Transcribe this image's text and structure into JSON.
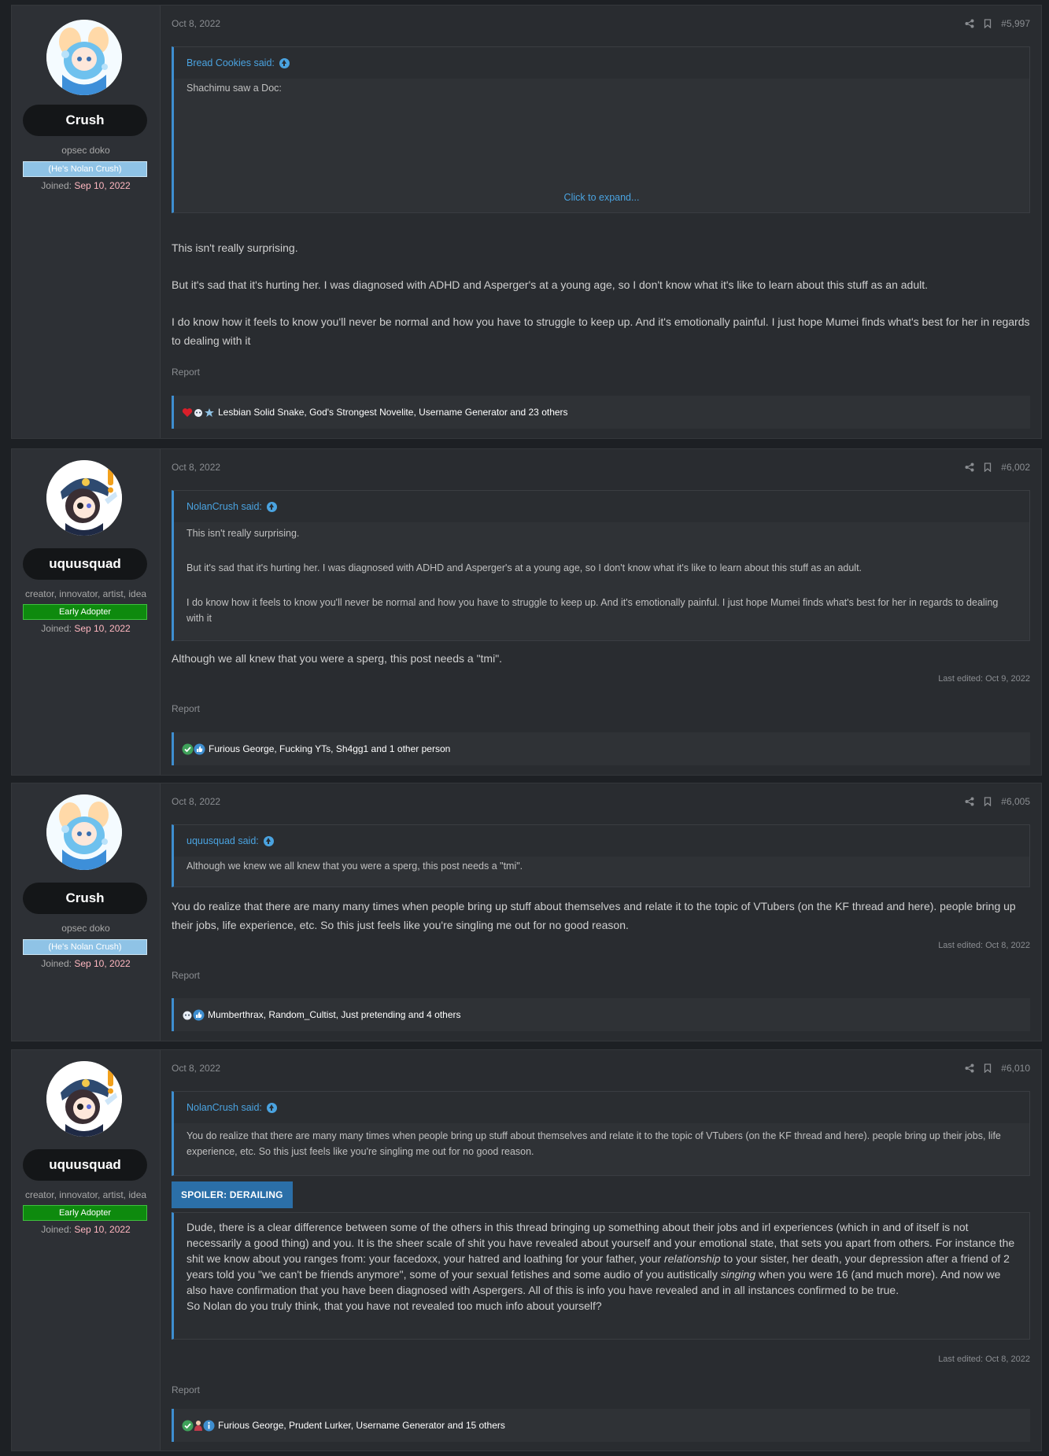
{
  "posts": [
    {
      "user": {
        "name": "Crush",
        "title": "opsec doko",
        "banner": "(He's Nolan Crush)",
        "joined_label": "Joined:",
        "joined": "Sep 10, 2022"
      },
      "date": "Oct 8, 2022",
      "number": "#5,997",
      "quote": {
        "author": "Bread Cookies said:",
        "lines": [
          "Shachimu saw a Doc:"
        ],
        "expand": "Click to expand..."
      },
      "body": [
        "This isn't really surprising.",
        "But it's sad that it's hurting her. I was diagnosed with ADHD and Asperger's at a young age, so I don't know what it's like to learn about this stuff as an adult.",
        "I do know how it feels to know you'll never be normal and how you have to struggle to keep up. And it's emotionally painful. I just hope Mumei finds what's best for her in regards to dealing with it"
      ],
      "report": "Report",
      "reactions": "Lesbian Solid Snake, God's Strongest Novelite, Username Generator and 23 others"
    },
    {
      "user": {
        "name": "uquusquad",
        "title": "creator, innovator, artist, idea",
        "banner": "Early Adopter",
        "joined_label": "Joined:",
        "joined": "Sep 10, 2022"
      },
      "date": "Oct 8, 2022",
      "number": "#6,002",
      "quote": {
        "author": "NolanCrush said:",
        "lines": [
          "This isn't really surprising.",
          "But it's sad that it's hurting her. I was diagnosed with ADHD and Asperger's at a young age, so I don't know what it's like to learn about this stuff as an adult.",
          "I do know how it feels to know you'll never be normal and how you have to struggle to keep up. And it's emotionally painful. I just hope Mumei finds what's best for her in regards to dealing with it"
        ]
      },
      "body": [
        "Although we all knew that you were a sperg, this post needs a \"tmi\"."
      ],
      "edited": "Last edited: Oct 9, 2022",
      "report": "Report",
      "reactions": "Furious George, Fucking YTs, Sh4gg1 and 1 other person"
    },
    {
      "user": {
        "name": "Crush",
        "title": "opsec doko",
        "banner": "(He's Nolan Crush)",
        "joined_label": "Joined:",
        "joined": "Sep 10, 2022"
      },
      "date": "Oct 8, 2022",
      "number": "#6,005",
      "quote": {
        "author": "uquusquad said:",
        "lines": [
          "Although we knew we all knew that you were a sperg, this post needs a \"tmi\"."
        ]
      },
      "body": [
        "You do realize that there are many many times when people bring up stuff about themselves and relate it to the topic of VTubers (on the KF thread and here). people bring up their jobs, life experience, etc. So this just feels like you're singling me out for no good reason."
      ],
      "edited": "Last edited: Oct 8, 2022",
      "report": "Report",
      "reactions": "Mumberthrax, Random_Cultist, Just pretending and 4 others"
    },
    {
      "user": {
        "name": "uquusquad",
        "title": "creator, innovator, artist, idea",
        "banner": "Early Adopter",
        "joined_label": "Joined:",
        "joined": "Sep 10, 2022"
      },
      "date": "Oct 8, 2022",
      "number": "#6,010",
      "quote": {
        "author": "NolanCrush said:",
        "lines": [
          "You do realize that there are many many times when people bring up stuff about themselves and relate it to the topic of VTubers (on the KF thread and here). people bring up their jobs, life experience, etc. So this just feels like you're singling me out for no good reason."
        ]
      },
      "spoiler": {
        "label": "SPOILER: DERAILING",
        "p1_a": "Dude, there is a clear difference between some of the others in this thread bringing up something about their jobs and irl experiences (which in and of itself is not necessarily a good thing) and you. It is the sheer scale of shit you have revealed about yourself and your emotional state, that sets you apart from others. For instance the shit we know about you ranges from: your facedoxx, your hatred and loathing for your father, your ",
        "p1_em1": "relationship",
        "p1_b": " to your sister, her death, your depression after a friend of 2 years told you \"we can't be friends anymore\", some of your sexual fetishes and some audio of you autistically ",
        "p1_em2": "singing",
        "p1_c": " when you were 16 (and much more). And now we also have confirmation that you have been diagnosed with Aspergers. All of this is info you have revealed and in all instances confirmed to be true.",
        "p2": "So Nolan do you truly think, that you have not revealed too much info about yourself?"
      },
      "edited": "Last edited: Oct 8, 2022",
      "report": "Report",
      "reactions": "Furious George, Prudent Lurker, Username Generator and 15 others"
    }
  ],
  "colors": {
    "accent": "#3e8ed0",
    "link": "#4aa3e0",
    "early_adopter": "#0e8a0e",
    "crush_banner": "#8fc3e6",
    "joined_date": "#ffb7c0"
  },
  "icons": {
    "share": "share-icon",
    "bookmark": "bookmark-icon",
    "quote_up": "arrow-up-circle-icon"
  }
}
